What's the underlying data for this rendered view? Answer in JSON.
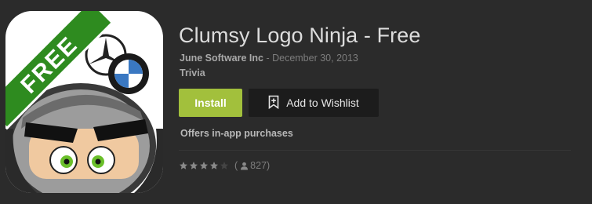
{
  "app": {
    "title": "Clumsy Logo Ninja - Free",
    "developer": "June Software Inc",
    "date_separator": " - ",
    "date": "December 30, 2013",
    "category": "Trivia",
    "icon_banner_text": "FREE"
  },
  "actions": {
    "install_label": "Install",
    "wishlist_label": "Add to Wishlist"
  },
  "in_app_purchases_label": "Offers in-app purchases",
  "rating": {
    "stars_filled": 4,
    "stars_total": 5,
    "open_paren": "(",
    "review_count": "827",
    "close_paren": ")"
  },
  "colors": {
    "background": "#2b2b2b",
    "install_button": "#a2c03c",
    "wishlist_button": "#1c1c1c",
    "free_banner": "#2e8b1f"
  },
  "icons": {
    "app_icon": "ninja-app-icon",
    "wishlist": "bookmark-plus-icon",
    "reviewer": "person-icon",
    "star": "star-icon"
  }
}
